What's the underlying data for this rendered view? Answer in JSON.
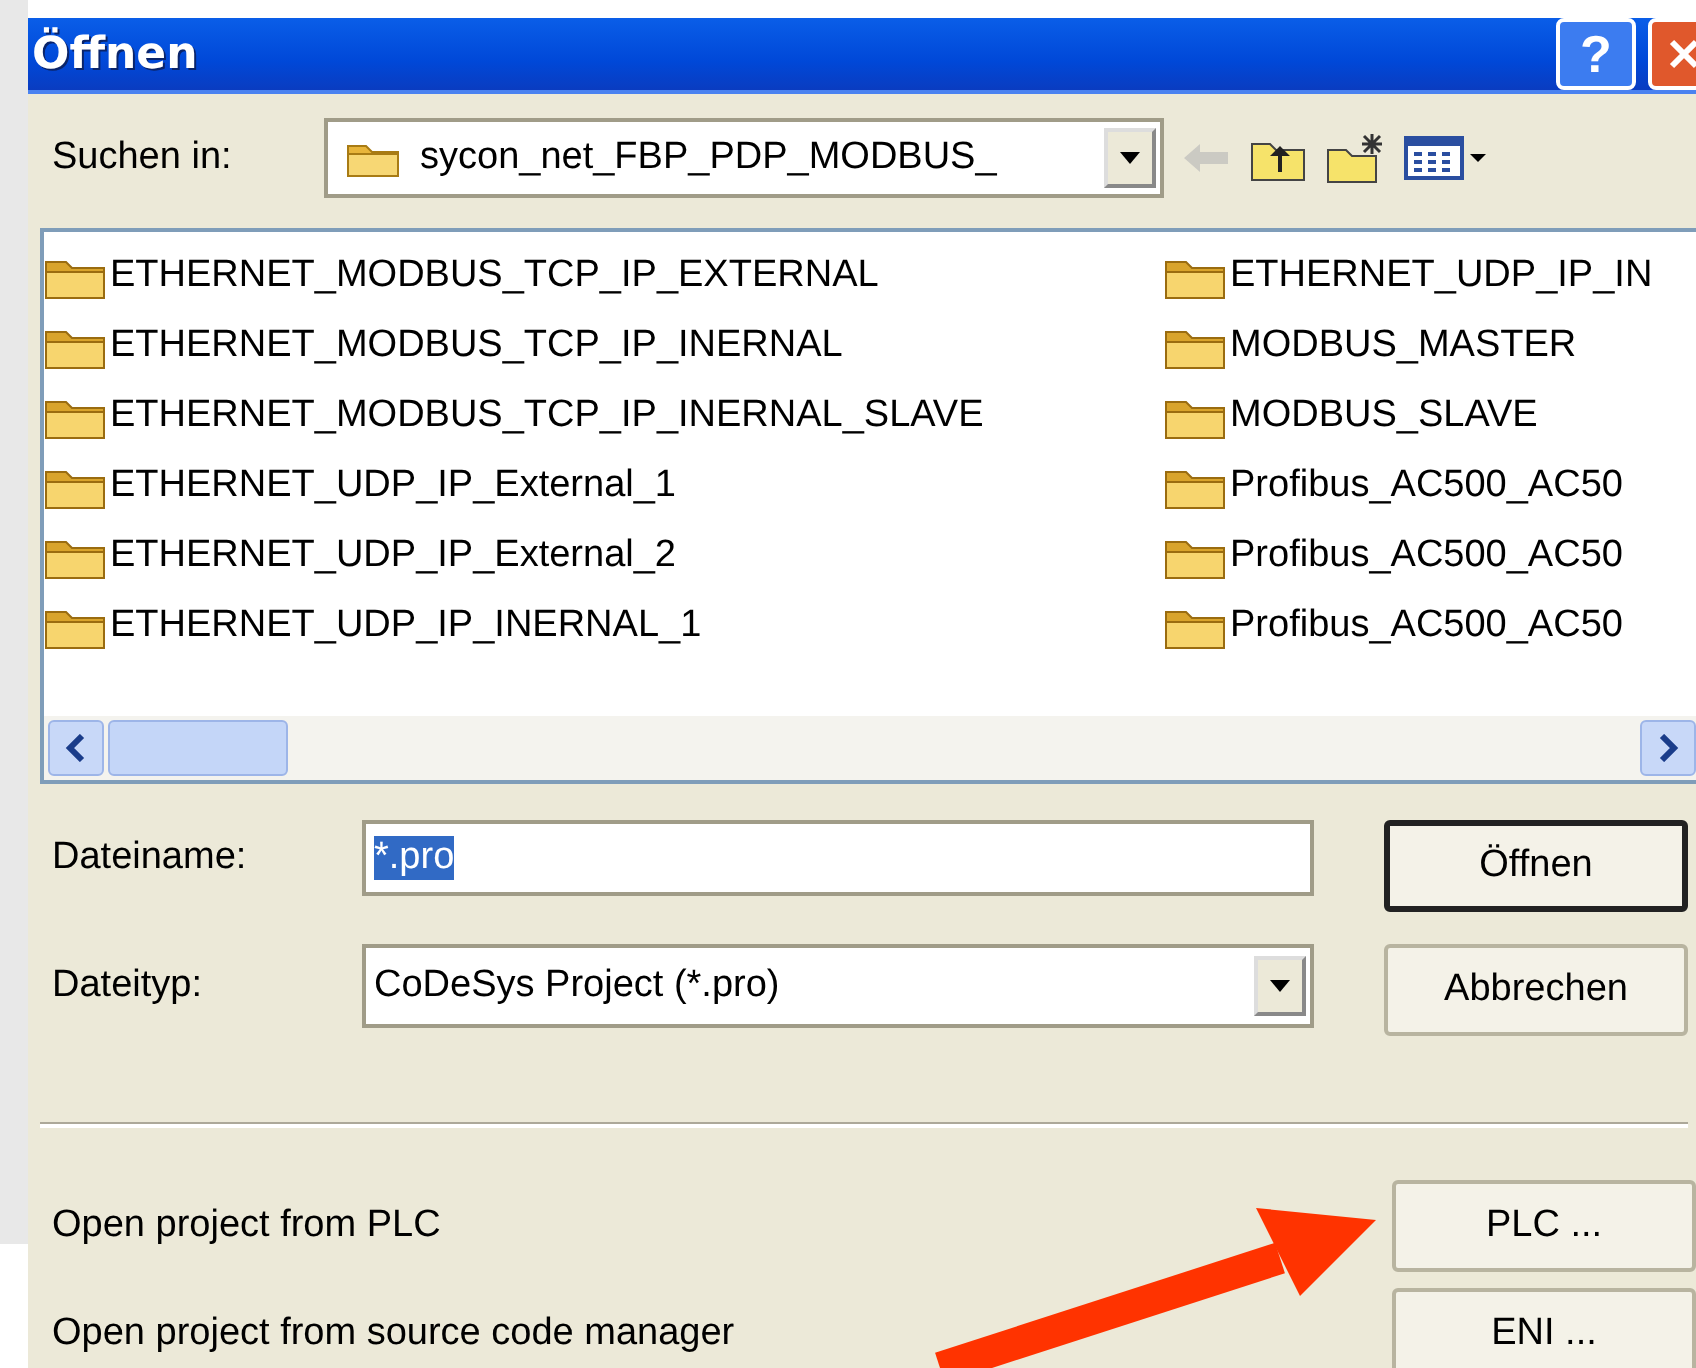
{
  "window": {
    "title": "Öffnen",
    "help_glyph": "?"
  },
  "look_in": {
    "label": "Suchen in:",
    "value": "sycon_net_FBP_PDP_MODBUS_"
  },
  "toolbar": [
    {
      "kind": "back",
      "disabled": true
    },
    {
      "kind": "up",
      "disabled": false
    },
    {
      "kind": "newfolder",
      "disabled": false
    },
    {
      "kind": "view",
      "disabled": false
    }
  ],
  "files": [
    {
      "name": "ETHERNET_MODBUS_TCP_IP_EXTERNAL"
    },
    {
      "name": "ETHERNET_MODBUS_TCP_IP_INERNAL"
    },
    {
      "name": "ETHERNET_MODBUS_TCP_IP_INERNAL_SLAVE"
    },
    {
      "name": "ETHERNET_UDP_IP_External_1"
    },
    {
      "name": "ETHERNET_UDP_IP_External_2"
    },
    {
      "name": "ETHERNET_UDP_IP_INERNAL_1"
    },
    {
      "name": "ETHERNET_UDP_IP_IN"
    },
    {
      "name": "MODBUS_MASTER"
    },
    {
      "name": "MODBUS_SLAVE"
    },
    {
      "name": "Profibus_AC500_AC50"
    },
    {
      "name": "Profibus_AC500_AC50"
    },
    {
      "name": "Profibus_AC500_AC50"
    }
  ],
  "filename": {
    "label": "Dateiname:",
    "value": "*.pro",
    "selected": true
  },
  "filetype": {
    "label": "Dateityp:",
    "value": "CoDeSys Project (*.pro)"
  },
  "buttons": [
    {
      "label": "Öffnen",
      "default": true
    },
    {
      "label": "Abbrechen",
      "default": false
    }
  ],
  "extra": [
    {
      "text": "Open project from PLC",
      "button": "PLC ..."
    },
    {
      "text": "Open project from source code manager",
      "button": "ENI ..."
    }
  ]
}
